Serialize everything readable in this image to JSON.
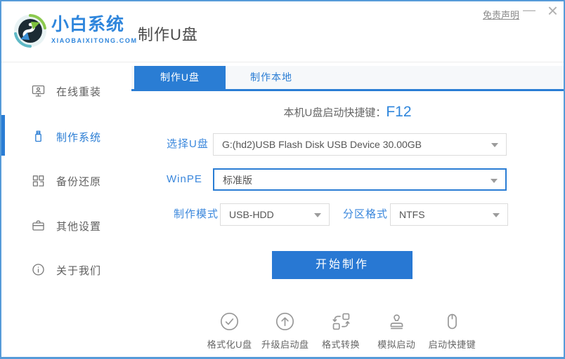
{
  "window": {
    "disclaimer": "免责声明",
    "minimize": "—",
    "close": "×"
  },
  "brand": {
    "name": "小白系统",
    "domain": "XIAOBAIXITONG.COM"
  },
  "header": {
    "title": "制作U盘"
  },
  "sidebar": {
    "items": [
      {
        "label": "在线重装",
        "icon": "online-reinstall-icon",
        "active": false
      },
      {
        "label": "制作系统",
        "icon": "make-system-icon",
        "active": true
      },
      {
        "label": "备份还原",
        "icon": "backup-restore-icon",
        "active": false
      },
      {
        "label": "其他设置",
        "icon": "other-settings-icon",
        "active": false
      },
      {
        "label": "关于我们",
        "icon": "about-us-icon",
        "active": false
      }
    ]
  },
  "tabs": [
    {
      "label": "制作U盘",
      "active": true
    },
    {
      "label": "制作本地",
      "active": false
    }
  ],
  "main": {
    "hotkey_label": "本机U盘启动快捷键：",
    "hotkey_value": "F12",
    "form": {
      "usb": {
        "label": "选择U盘",
        "value": "G:(hd2)USB Flash Disk USB Device 30.00GB"
      },
      "winpe": {
        "label": "WinPE",
        "value": "标准版"
      },
      "mode": {
        "label": "制作模式",
        "value": "USB-HDD"
      },
      "partition": {
        "label": "分区格式",
        "value": "NTFS"
      }
    },
    "start_button": "开始制作"
  },
  "footer": {
    "tools": [
      {
        "label": "格式化U盘",
        "icon": "format-usb-icon"
      },
      {
        "label": "升级启动盘",
        "icon": "upgrade-boot-icon"
      },
      {
        "label": "格式转换",
        "icon": "format-convert-icon"
      },
      {
        "label": "模拟启动",
        "icon": "simulate-boot-icon"
      },
      {
        "label": "启动快捷键",
        "icon": "boot-hotkey-icon"
      }
    ]
  },
  "colors": {
    "accent": "#2a7dd4",
    "button_blue": "#2878d3",
    "window_border": "#569bd9",
    "label_blue": "#3a87dc",
    "brand_blue": "#2f86dc"
  }
}
